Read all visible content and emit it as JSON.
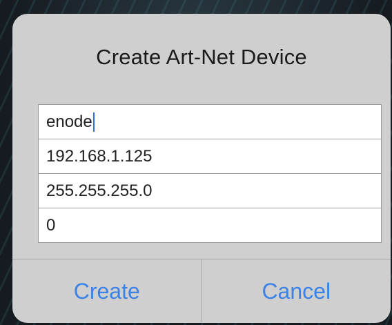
{
  "dialog": {
    "title": "Create Art-Net Device",
    "fields": [
      {
        "value": "enode",
        "focused": true
      },
      {
        "value": "192.168.1.125"
      },
      {
        "value": "255.255.255.0"
      },
      {
        "value": "0"
      }
    ],
    "buttons": {
      "create_label": "Create",
      "cancel_label": "Cancel"
    }
  },
  "colors": {
    "accent": "#3b82e6",
    "caret": "#2f6fe0"
  }
}
